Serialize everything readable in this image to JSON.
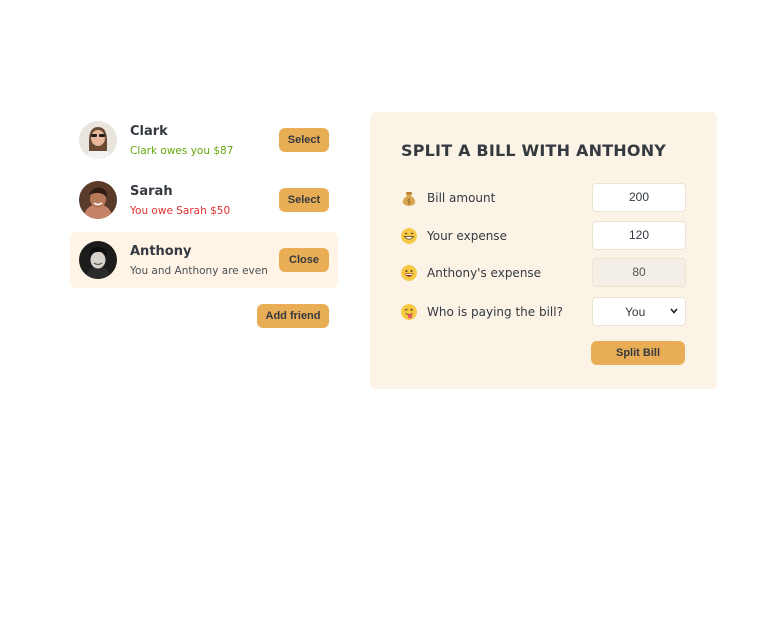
{
  "friends": [
    {
      "name": "Clark",
      "status": "Clark owes you $87",
      "status_type": "green",
      "button": "Select",
      "selected": false
    },
    {
      "name": "Sarah",
      "status": "You owe Sarah $50",
      "status_type": "red",
      "button": "Select",
      "selected": false
    },
    {
      "name": "Anthony",
      "status": "You and Anthony are even",
      "status_type": "neutral",
      "button": "Close",
      "selected": true
    }
  ],
  "add_friend_label": "Add friend",
  "split_form": {
    "title": "SPLIT A BILL WITH ANTHONY",
    "bill_amount": {
      "emoji": "money-bag-icon",
      "label": "Bill amount",
      "value": "200"
    },
    "your_expense": {
      "emoji": "grinning-face-icon",
      "label": "Your expense",
      "value": "120"
    },
    "friend_expense": {
      "emoji": "laughing-face-icon",
      "label": "Anthony's expense",
      "value": "80"
    },
    "payer": {
      "emoji": "tongue-face-icon",
      "label": "Who is paying the bill?",
      "selected": "You"
    },
    "submit_label": "Split Bill"
  },
  "colors": {
    "accent": "#e9ad55",
    "panel_bg": "#fbf3e6",
    "positive": "#66a80f",
    "negative": "#e03131"
  }
}
